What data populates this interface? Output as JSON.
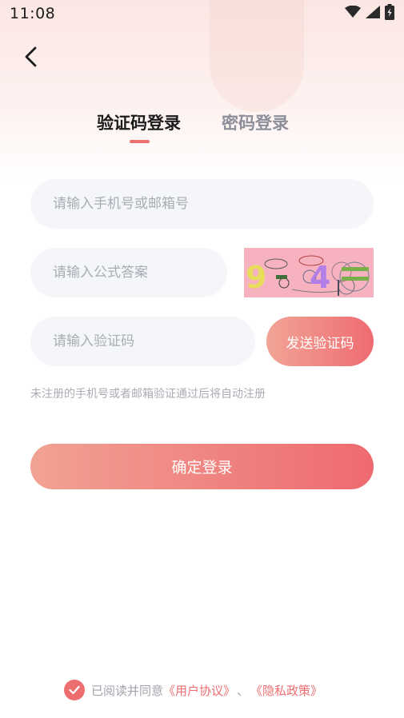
{
  "status_bar": {
    "time": "11:08",
    "icons": [
      "wifi-icon",
      "signal-icon",
      "battery-icon"
    ]
  },
  "nav": {
    "back_icon": "chevron-left-icon"
  },
  "tabs": [
    {
      "label": "验证码登录",
      "active": true
    },
    {
      "label": "密码登录",
      "active": false
    }
  ],
  "form": {
    "phone_placeholder": "请输入手机号或邮箱号",
    "formula_placeholder": "请输入公式答案",
    "captcha_text": "9-4=",
    "code_placeholder": "请输入验证码",
    "send_code_label": "发送验证码",
    "hint": "未注册的手机号或者邮箱验证通过后将自动注册",
    "confirm_label": "确定登录"
  },
  "agreement": {
    "checked": true,
    "prefix": "已阅读并同意",
    "user_agreement": "《用户协议》",
    "separator": "、",
    "privacy_policy": "《隐私政策》"
  },
  "colors": {
    "accent": "#ee6e70",
    "gradient_start": "#f2a596",
    "gradient_end": "#ee6b72"
  }
}
